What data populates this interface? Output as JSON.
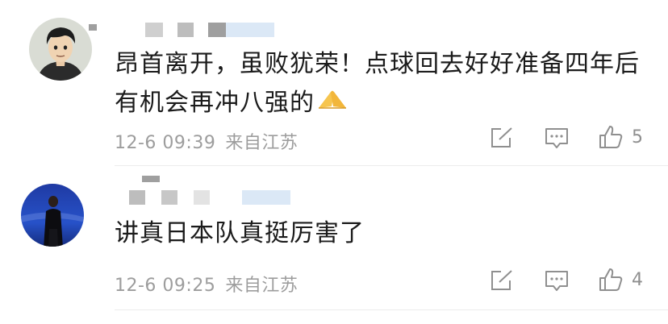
{
  "comments": [
    {
      "text_line1": "昂首离开，虽败犹荣！点球回去好好准备四年后",
      "text_line2": "有机会再冲八强的",
      "emoji": "folded-hands-emoji",
      "timestamp": "12-6 09:39",
      "location": "来自江苏",
      "like_count": "5"
    },
    {
      "text_line1": "讲真日本队真挺厉害了",
      "timestamp": "12-6 09:25",
      "location": "来自江苏",
      "like_count": "4"
    }
  ],
  "colors": {
    "text": "#1b1b1b",
    "meta": "#9d9d9d",
    "icon": "#8f8f8f",
    "divider": "#ececec",
    "username_blur_gray": "#bdbdbd",
    "username_blur_blue": "#dbe8f6"
  }
}
